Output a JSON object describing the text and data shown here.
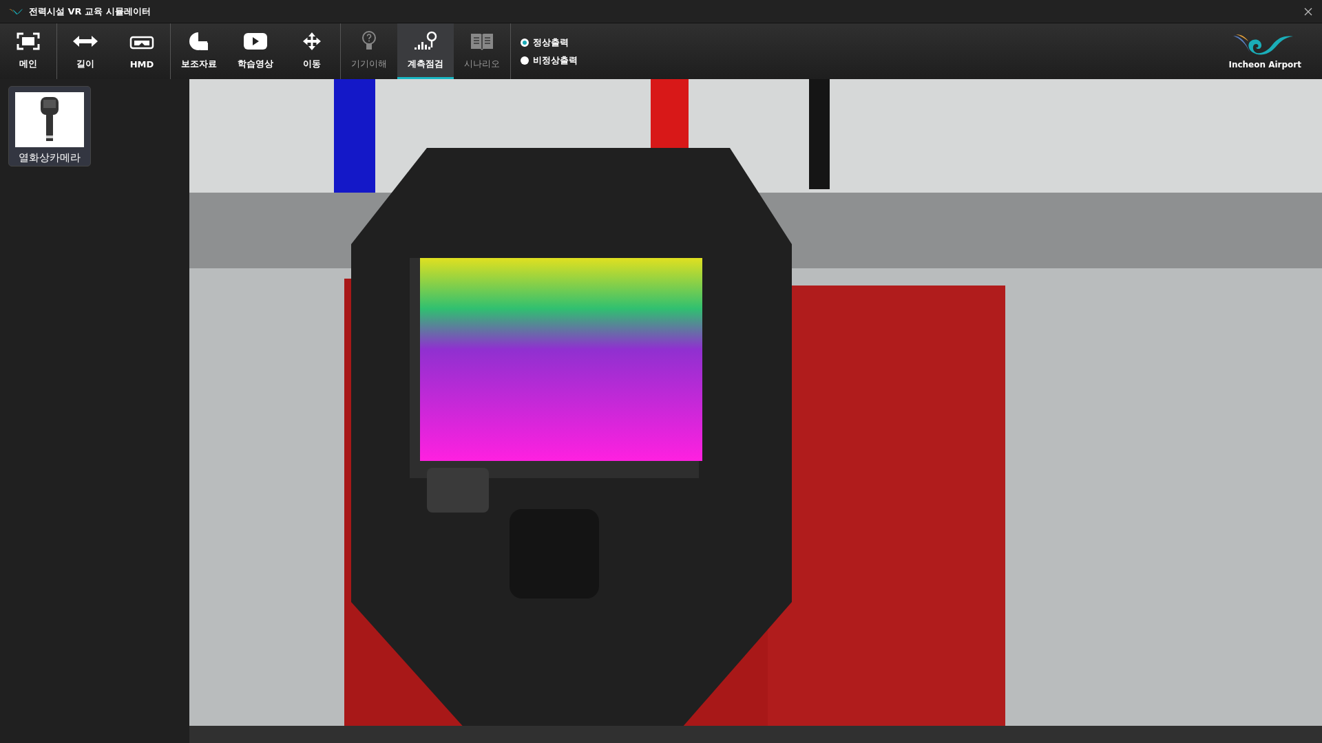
{
  "window": {
    "title": "전력시설 VR 교육 시뮬레이터"
  },
  "toolbar": {
    "groups": [
      [
        {
          "label": "메인",
          "selected": false,
          "disabled": false
        }
      ],
      [
        {
          "label": "길이",
          "selected": false,
          "disabled": false
        },
        {
          "label": "HMD",
          "selected": false,
          "disabled": false
        }
      ],
      [
        {
          "label": "보조자료",
          "selected": false,
          "disabled": false
        },
        {
          "label": "학습영상",
          "selected": false,
          "disabled": false
        },
        {
          "label": "이동",
          "selected": false,
          "disabled": false
        }
      ],
      [
        {
          "label": "기기이해",
          "selected": false,
          "disabled": true
        },
        {
          "label": "계측점검",
          "selected": true,
          "disabled": false
        },
        {
          "label": "시나리오",
          "selected": false,
          "disabled": true
        }
      ]
    ],
    "output_mode": [
      {
        "label": "정상출력",
        "selected": true
      },
      {
        "label": "비정상출력",
        "selected": false
      }
    ]
  },
  "logo": {
    "text": "Incheon Airport"
  },
  "sidebar": {
    "items": [
      {
        "label": "열화상카메라",
        "selected": false
      }
    ]
  }
}
